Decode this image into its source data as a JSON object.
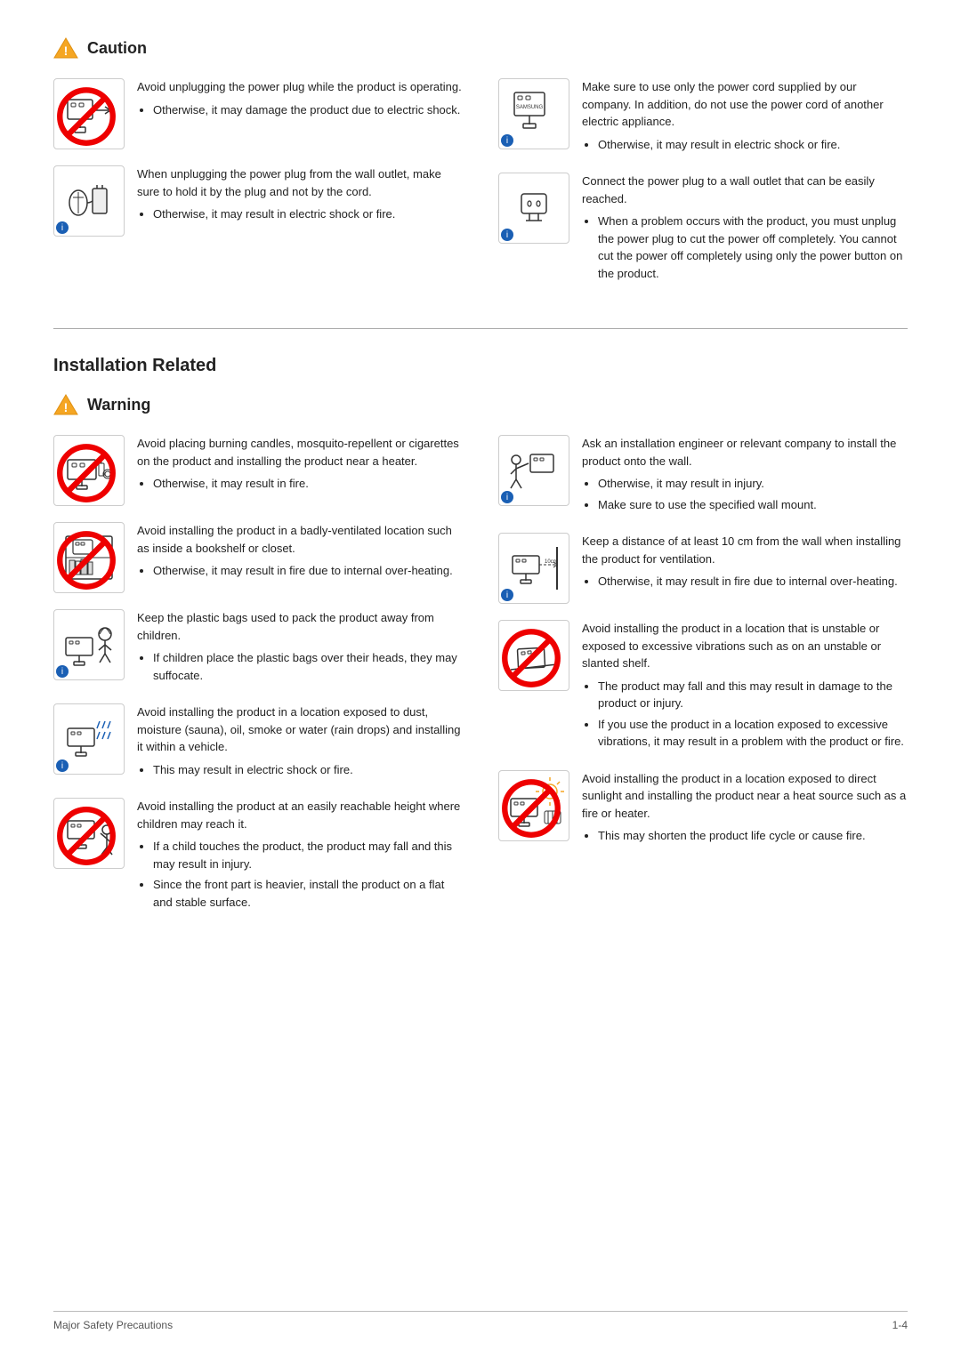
{
  "caution": {
    "title": "Caution",
    "icon_label": "caution-warning-icon",
    "entries_left": [
      {
        "id": "caution-1",
        "icon_type": "plug_unplug",
        "has_no_sign": true,
        "has_blue_dot": false,
        "text": "Avoid unplugging the power plug while the product is operating.",
        "bullets": [
          "Otherwise, it may damage the product due to electric shock."
        ]
      },
      {
        "id": "caution-2",
        "icon_type": "plug_wall",
        "has_no_sign": false,
        "has_blue_dot": true,
        "text": "When unplugging the power plug from the wall outlet, make sure to hold it by the plug and not by the cord.",
        "bullets": [
          "Otherwise, it may result in electric shock or fire."
        ]
      }
    ],
    "entries_right": [
      {
        "id": "caution-3",
        "icon_type": "power_cord",
        "has_no_sign": false,
        "has_blue_dot": true,
        "text": "Make sure to use only the power cord supplied by our company. In addition, do not use the power cord of another electric appliance.",
        "bullets": [
          "Otherwise, it may result in electric shock or fire."
        ]
      },
      {
        "id": "caution-4",
        "icon_type": "wall_outlet",
        "has_no_sign": false,
        "has_blue_dot": true,
        "text": "Connect the power plug to a wall outlet that can be easily reached.",
        "bullets": [
          "When a problem occurs with the product, you must unplug the power plug to cut the power off completely. You cannot cut the power off completely using only the power button on the product."
        ]
      }
    ]
  },
  "installation": {
    "title": "Installation Related",
    "warning": {
      "title": "Warning",
      "entries_left": [
        {
          "id": "warn-1",
          "icon_type": "candles",
          "has_no_sign": true,
          "has_blue_dot": false,
          "text": "Avoid placing burning candles,  mosquito-repellent or cigarettes on the product and installing the product near a heater.",
          "bullets": [
            "Otherwise, it may result in fire."
          ]
        },
        {
          "id": "warn-2",
          "icon_type": "bookshelf",
          "has_no_sign": true,
          "has_blue_dot": false,
          "text": "Avoid installing the product in a badly-ventilated location such as inside a bookshelf or closet.",
          "bullets": [
            "Otherwise, it may result in fire due to internal over-heating."
          ]
        },
        {
          "id": "warn-3",
          "icon_type": "plastic_bag",
          "has_no_sign": false,
          "has_blue_dot": true,
          "text": "Keep the plastic bags used to pack the product away from children.",
          "bullets": [
            "If children place the plastic bags over their heads, they may suffocate."
          ]
        },
        {
          "id": "warn-6",
          "icon_type": "dust_moisture",
          "has_no_sign": false,
          "has_blue_dot": true,
          "text": "Avoid installing the product in a location exposed to dust, moisture (sauna), oil, smoke or water (rain drops) and installing it within a vehicle.",
          "bullets": [
            "This may result in electric shock or fire."
          ]
        },
        {
          "id": "warn-7",
          "icon_type": "children_height",
          "has_no_sign": true,
          "has_blue_dot": false,
          "text": "Avoid installing the product at an easily reachable height where children may reach it.",
          "bullets": [
            "If a child touches the product, the product may fall and this may result in injury.",
            "Since the front part is heavier, install the product on a flat and stable surface."
          ]
        }
      ],
      "entries_right": [
        {
          "id": "warn-4",
          "icon_type": "wall_mount",
          "has_no_sign": false,
          "has_blue_dot": true,
          "text": "Ask an installation engineer or relevant company to install the product onto the wall.",
          "bullets": [
            "Otherwise, it may result in injury.",
            "Make sure to use the specified wall mount."
          ]
        },
        {
          "id": "warn-5",
          "icon_type": "ventilation",
          "has_no_sign": false,
          "has_blue_dot": true,
          "text": "Keep a distance of at least 10 cm from the wall when installing the product for ventilation.",
          "bullets": [
            "Otherwise, it may result in fire due to internal over-heating."
          ]
        },
        {
          "id": "warn-5b",
          "icon_type": "unstable_shelf",
          "has_no_sign": true,
          "has_blue_dot": false,
          "text": "Avoid installing the product in a location that is unstable or exposed to excessive vibrations such as on an unstable or slanted shelf.",
          "bullets": [
            "The product may fall and this may result in damage to the product or injury.",
            "If you use the product in a location exposed to excessive vibrations, it may result in a problem with the product or fire."
          ]
        },
        {
          "id": "warn-8",
          "icon_type": "sunlight",
          "has_no_sign": true,
          "has_blue_dot": false,
          "text": "Avoid installing the product in a location exposed to direct sunlight and installing the product near a heat source such as a fire or heater.",
          "bullets": [
            "This may shorten the product life cycle or cause fire."
          ]
        }
      ]
    }
  },
  "footer": {
    "left": "Major Safety Precautions",
    "right": "1-4"
  }
}
